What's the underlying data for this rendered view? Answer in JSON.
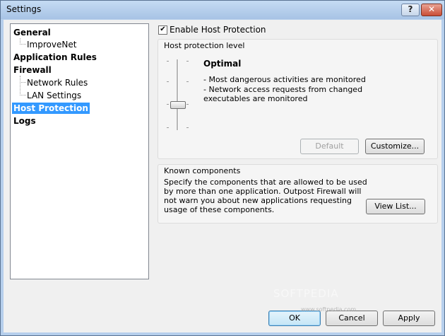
{
  "window": {
    "title": "Settings",
    "help_label": "?",
    "close_label": "✕"
  },
  "tree": {
    "items": [
      {
        "label": "General",
        "level": 0
      },
      {
        "label": "ImproveNet",
        "level": 1
      },
      {
        "label": "Application Rules",
        "level": 0
      },
      {
        "label": "Firewall",
        "level": 0
      },
      {
        "label": "Network Rules",
        "level": 1
      },
      {
        "label": "LAN Settings",
        "level": 1
      },
      {
        "label": "Host Protection",
        "level": 0,
        "selected": true
      },
      {
        "label": "Logs",
        "level": 0
      }
    ]
  },
  "host_protection": {
    "enable_label": "Enable Host Protection",
    "enabled": true,
    "level_group_title": "Host protection level",
    "level_name": "Optimal",
    "level_desc_1": "- Most dangerous activities are monitored",
    "level_desc_2": "- Network access requests from changed executables are monitored",
    "default_button": "Default",
    "customize_button": "Customize..."
  },
  "known_components": {
    "title": "Known components",
    "description": "Specify the components that are allowed to be used by more than one application. Outpost Firewall will not warn you about new applications requesting usage of these components.",
    "view_list_button": "View List..."
  },
  "footer": {
    "ok_label": "OK",
    "cancel_label": "Cancel",
    "apply_label": "Apply"
  },
  "watermark": {
    "main": "SOFTPEDIA",
    "sub": "www.softpedia.com"
  }
}
